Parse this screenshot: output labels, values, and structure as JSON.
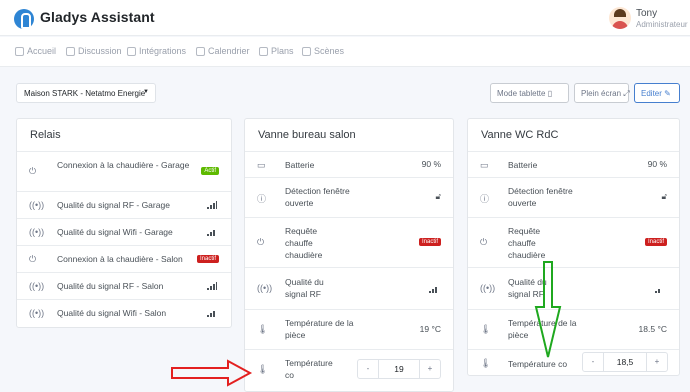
{
  "header": {
    "brand": "Gladys Assistant",
    "user_name": "Tony",
    "user_role": "Administrateur"
  },
  "nav": [
    "Accueil",
    "Discussion",
    "Intégrations",
    "Calendrier",
    "Plans",
    "Scènes"
  ],
  "toolbar": {
    "house_select": "Maison STARK - Netatmo Energie",
    "tablet_mode": "Mode tablette",
    "fullscreen": "Plein écran",
    "edit": "Editer"
  },
  "cards": {
    "relais": {
      "title": "Relais",
      "rows": [
        {
          "label": "Connexion à la chaudière - Garage",
          "badge": "Actif"
        },
        {
          "label": "Qualité du signal RF - Garage",
          "bars": 4
        },
        {
          "label": "Qualité du signal Wifi - Garage",
          "bars": 3
        },
        {
          "label": "Connexion à la chaudière - Salon",
          "badge": "Inactif"
        },
        {
          "label": "Qualité du signal RF - Salon",
          "bars": 4
        },
        {
          "label": "Qualité du signal Wifi - Salon",
          "bars": 3
        }
      ]
    },
    "vanne_bureau": {
      "title": "Vanne bureau salon",
      "rows": [
        {
          "label": "Batterie",
          "value": "90 %"
        },
        {
          "label": "Détection fenêtre ouverte"
        },
        {
          "label": "Requête chauffe chaudière",
          "badge": "Inactif"
        },
        {
          "label": "Qualité du signal RF",
          "bars": 3
        },
        {
          "label": "Température de la pièce",
          "value": "19 °C"
        },
        {
          "label": "Température co",
          "stepper": {
            "minus": "-",
            "value": "19",
            "plus": "+"
          }
        }
      ]
    },
    "vanne_wc": {
      "title": "Vanne WC RdC",
      "rows": [
        {
          "label": "Batterie",
          "value": "90 %"
        },
        {
          "label": "Détection fenêtre ouverte"
        },
        {
          "label": "Requête chauffe chaudière",
          "badge": "Inactif"
        },
        {
          "label": "Qualité du signal RF",
          "bars": 2
        },
        {
          "label": "Température de la pièce",
          "value": "18.5 °C"
        },
        {
          "label": "Température co",
          "stepper": {
            "minus": "-",
            "value": "18,5",
            "plus": "+"
          }
        }
      ]
    }
  },
  "colors": {
    "active": "#5eba00",
    "inactive": "#cd201f",
    "primary": "#467fcf",
    "annotation_red": "#e32020",
    "annotation_green": "#1fa81f"
  },
  "icons": {
    "power": "power-icon",
    "signal": "signal-icon",
    "battery": "battery-icon",
    "window": "info-icon",
    "lock": "lock-open-icon",
    "thermometer": "thermometer-icon"
  }
}
